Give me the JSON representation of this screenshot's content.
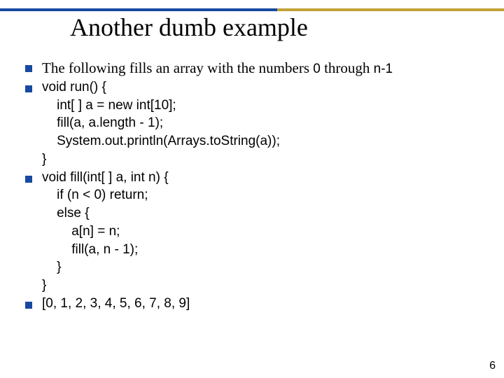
{
  "title": "Another dumb example",
  "intro_prefix": "The following fills an array with the numbers ",
  "intro_mid": " through ",
  "code_zero": "0",
  "code_n1": "n-1",
  "code": {
    "l1": "void run() {",
    "l2": "    int[ ] a = new int[10];",
    "l3": "    fill(a, a.length - 1);",
    "l4": "    System.out.println(Arrays.toString(a));",
    "l5": "}",
    "l6": "void fill(int[ ] a, int n) {",
    "l7": "    if (n < 0) return;",
    "l8": "    else {",
    "l9": "        a[n] = n;",
    "l10": "        fill(a, n - 1);",
    "l11": "    }",
    "l12": "}",
    "output": "[0, 1, 2, 3, 4, 5, 6, 7, 8, 9]"
  },
  "page_number": "6"
}
